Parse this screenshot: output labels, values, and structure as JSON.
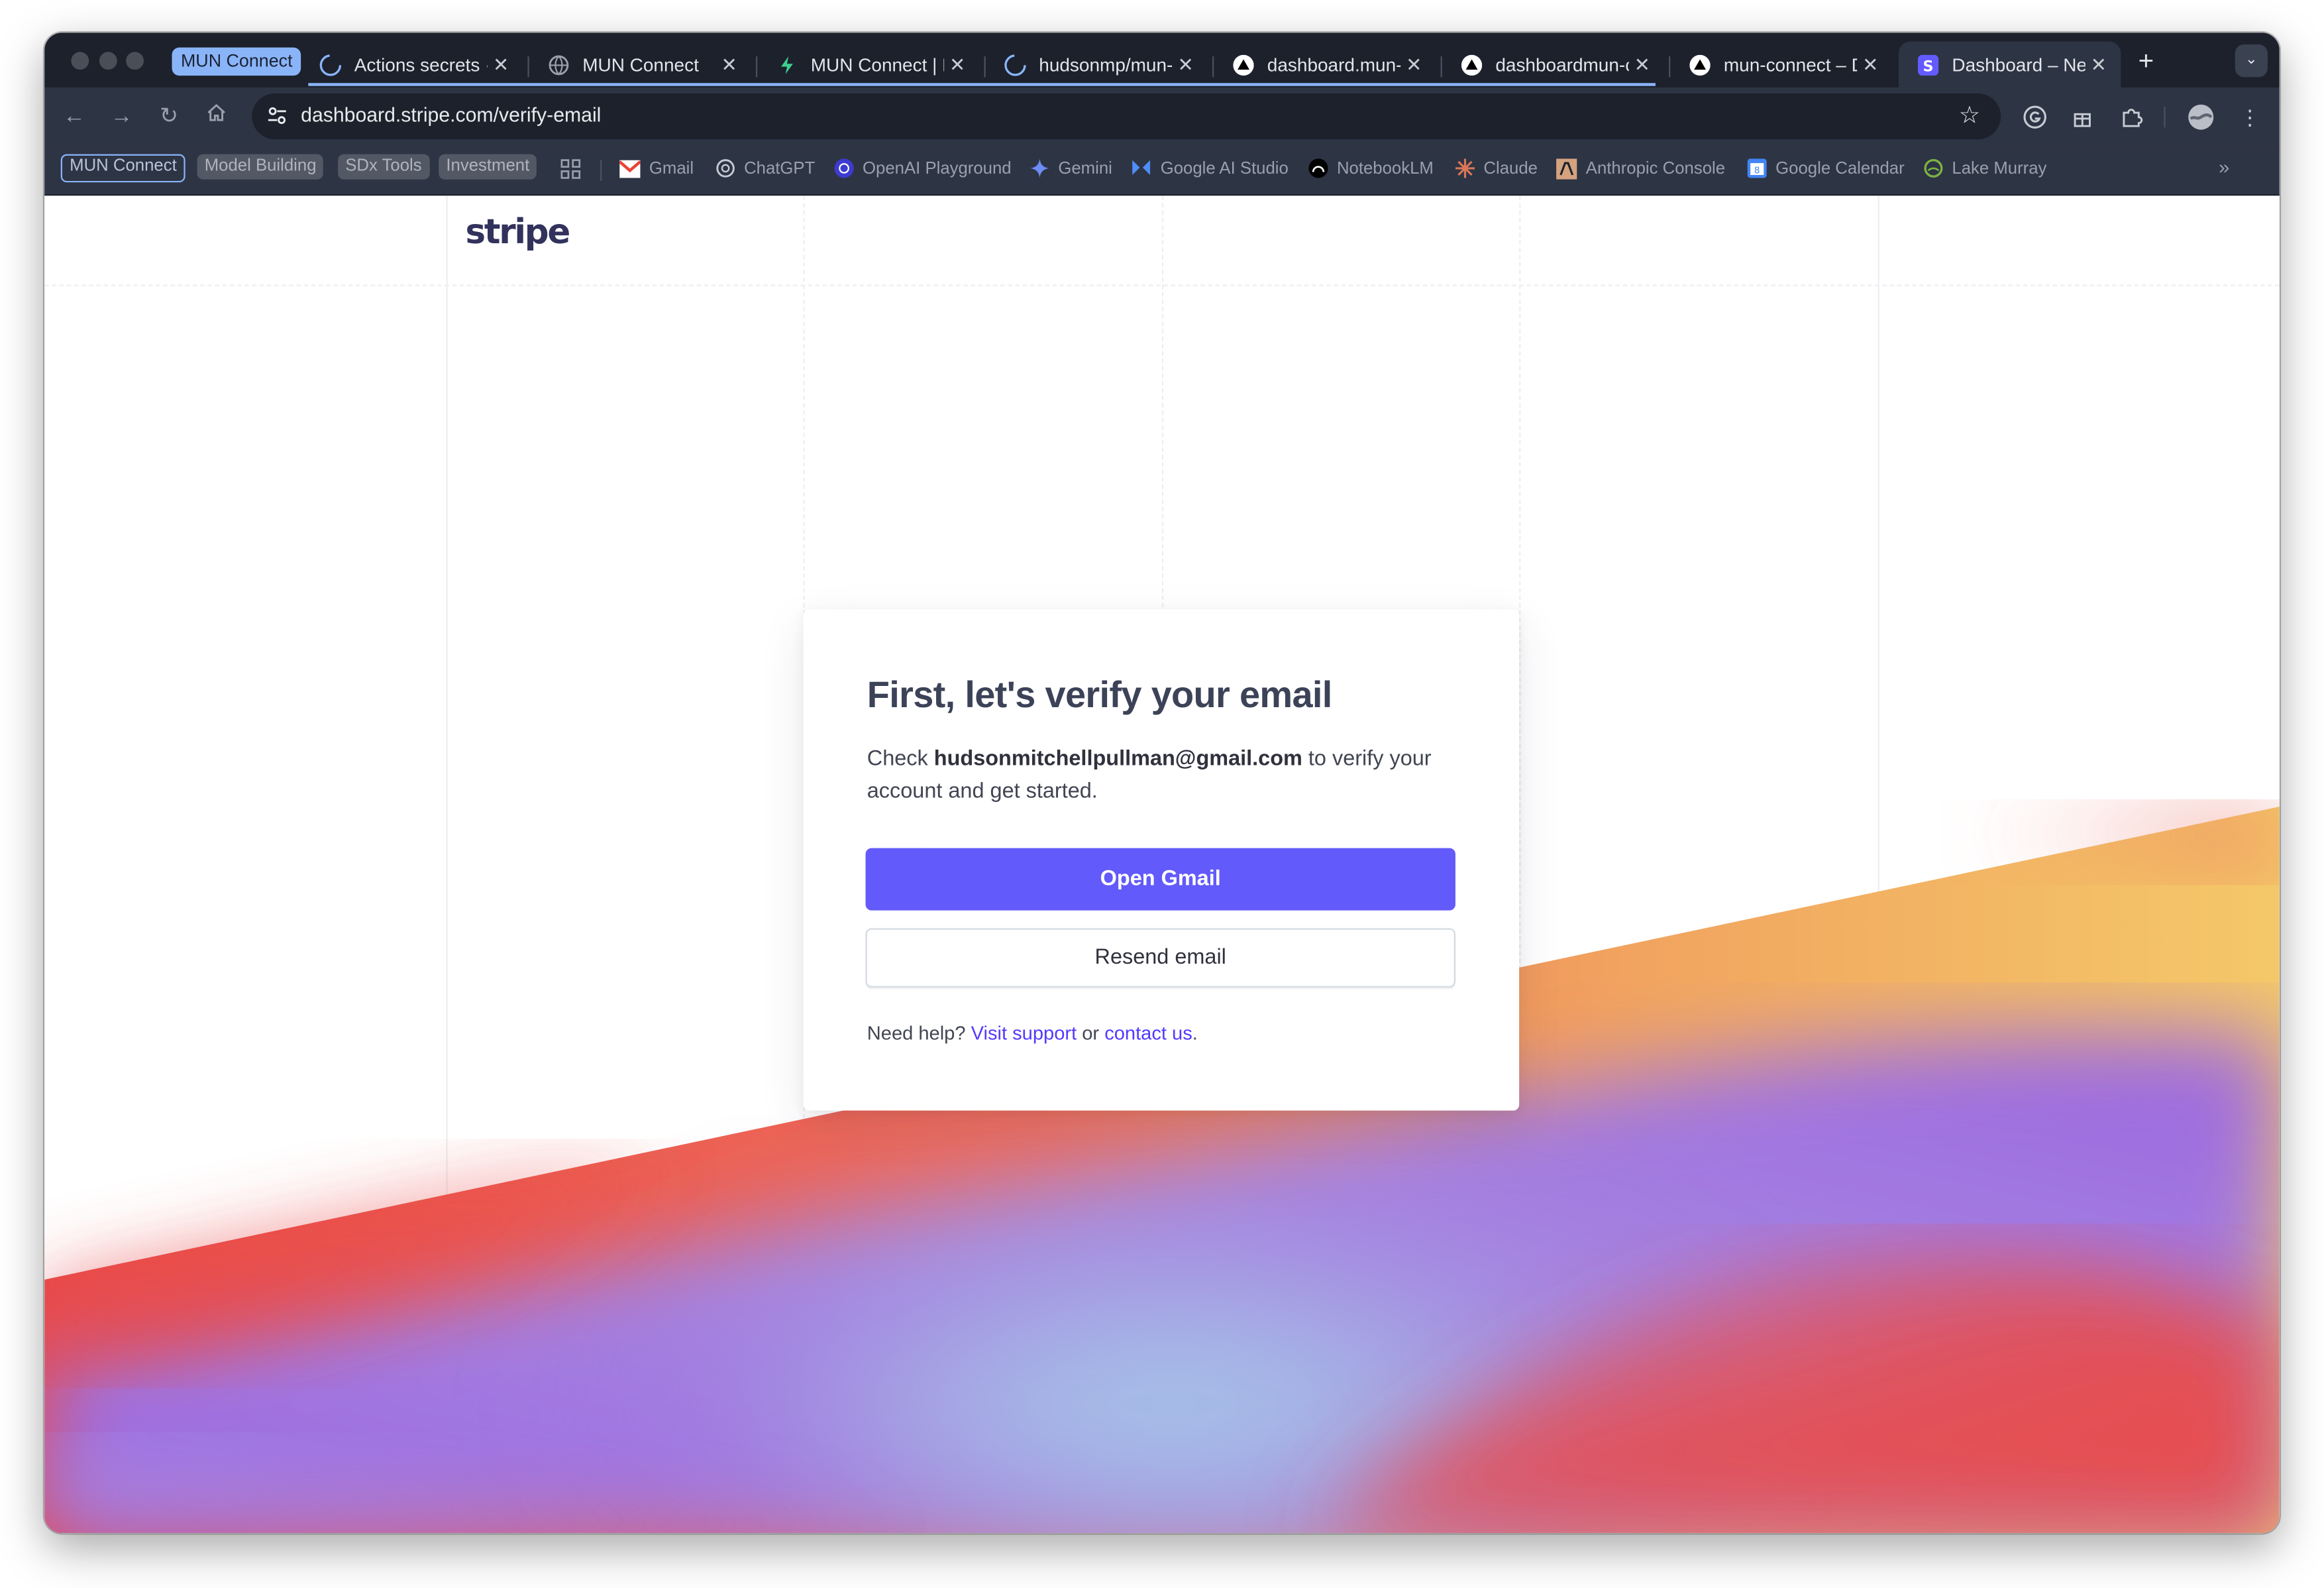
{
  "browser": {
    "group_label": "MUN Connect",
    "tabs": [
      {
        "title": "Actions secrets · ",
        "icon": "loading-icon"
      },
      {
        "title": "MUN Connect",
        "icon": "globe-icon"
      },
      {
        "title": "MUN Connect | H",
        "icon": "bolt-icon"
      },
      {
        "title": "hudsonmp/mun-c",
        "icon": "loading-icon"
      },
      {
        "title": "dashboard.mun-c",
        "icon": "vercel-icon"
      },
      {
        "title": "dashboardmun-c",
        "icon": "vercel-icon"
      },
      {
        "title": "mun-connect – D",
        "icon": "vercel-icon"
      },
      {
        "title": "Dashboard – New",
        "icon": "stripe-icon"
      }
    ],
    "url": "dashboard.stripe.com/verify-email",
    "bookmarks": {
      "chips": [
        "MUN Connect",
        "Model Building",
        "SDx Tools",
        "Investment"
      ],
      "items": [
        {
          "label": "Gmail",
          "icon": "gmail-icon"
        },
        {
          "label": "ChatGPT",
          "icon": "openai-icon"
        },
        {
          "label": "OpenAI Playground",
          "icon": "openai-playground-icon"
        },
        {
          "label": "Gemini",
          "icon": "gemini-icon"
        },
        {
          "label": "Google AI Studio",
          "icon": "ai-studio-icon"
        },
        {
          "label": "NotebookLM",
          "icon": "notebooklm-icon"
        },
        {
          "label": "Claude",
          "icon": "claude-icon"
        },
        {
          "label": "Anthropic Console",
          "icon": "anthropic-icon"
        },
        {
          "label": "Google Calendar",
          "icon": "calendar-icon"
        },
        {
          "label": "Lake Murray",
          "icon": "lake-murray-icon"
        }
      ]
    }
  },
  "page": {
    "logo": "stripe",
    "card": {
      "heading": "First, let's verify your email",
      "desc_prefix": "Check ",
      "email": "hudsonmitchellpullman@gmail.com",
      "desc_suffix": " to verify your account and get started.",
      "primary_button": "Open Gmail",
      "secondary_button": "Resend email",
      "help_prefix": "Need help? ",
      "support_link": "Visit support",
      "help_or": " or ",
      "contact_link": "contact us",
      "help_end": "."
    },
    "colors": {
      "accent": "#625afa",
      "link": "#533afd",
      "wave_red": "#ea4a47",
      "wave_yellow": "#f4c869",
      "wave_purple": "#9b66e0",
      "wave_blue": "#a5d3ec"
    }
  }
}
